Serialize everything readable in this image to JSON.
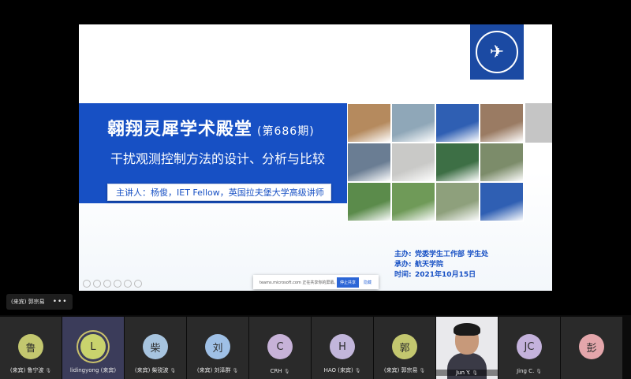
{
  "slide": {
    "title": "翱翔灵犀学术殿堂",
    "issue": "(第686期)",
    "subtitle": "干扰观测控制方法的设计、分析与比较",
    "speaker": "主讲人：杨俊，IET Fellow，英国拉夫堡大学高级讲师",
    "organizers": [
      {
        "label": "主办:",
        "value": "党委学生工作部 学生处"
      },
      {
        "label": "承办:",
        "value": "航天学院"
      },
      {
        "label": "时间:",
        "value": "2021年10月15日"
      }
    ],
    "photo_colors": [
      "#b58a5e",
      "#8fa7b8",
      "#2f5fb3",
      "#9a7b63",
      "#6a7d93",
      "#c9c9c7",
      "#3d6f45",
      "#7c8c6a",
      "#5b8b4b",
      "#6f9a58",
      "#8ea07c",
      "#2f5fb3"
    ]
  },
  "share_bar": {
    "text": "teams.microsoft.com 正在共享你的屏幕。",
    "stop_label": "停止共享",
    "hide_label": "隐藏"
  },
  "presenter_chip": {
    "name": "(来宾) 郭宗易",
    "more": "•••"
  },
  "participants": [
    {
      "initial": "鲁",
      "name": "(来宾) 鲁宁波",
      "color": "#c3c76f",
      "mic": "🎙"
    },
    {
      "initial": "L",
      "name": "lidingyong (来宾)",
      "color": "#c9d36d",
      "mic": "",
      "active": true
    },
    {
      "initial": "柴",
      "name": "(来宾) 柴锐波",
      "color": "#a7c4df",
      "mic": "🎙"
    },
    {
      "initial": "刘",
      "name": "(来宾) 刘泽群",
      "color": "#9fc0e6",
      "mic": "🎙"
    },
    {
      "initial": "C",
      "name": "CRH",
      "color": "#c7b2d8",
      "mic": "🎙"
    },
    {
      "initial": "H",
      "name": "HAO (来宾)",
      "color": "#c2b6db",
      "mic": "🎙"
    },
    {
      "initial": "郭",
      "name": "(来宾) 郭宗易",
      "color": "#c3c76f",
      "mic": "🎙"
    },
    {
      "initial": "",
      "name": "Jun Y.",
      "color": "#e9e9ec",
      "mic": "🎙",
      "video": true
    },
    {
      "initial": "JC",
      "name": "Jing C.",
      "color": "#c4b2dc",
      "mic": "🎙"
    },
    {
      "initial": "彭",
      "name": "",
      "color": "#e4a6ab",
      "mic": ""
    }
  ]
}
